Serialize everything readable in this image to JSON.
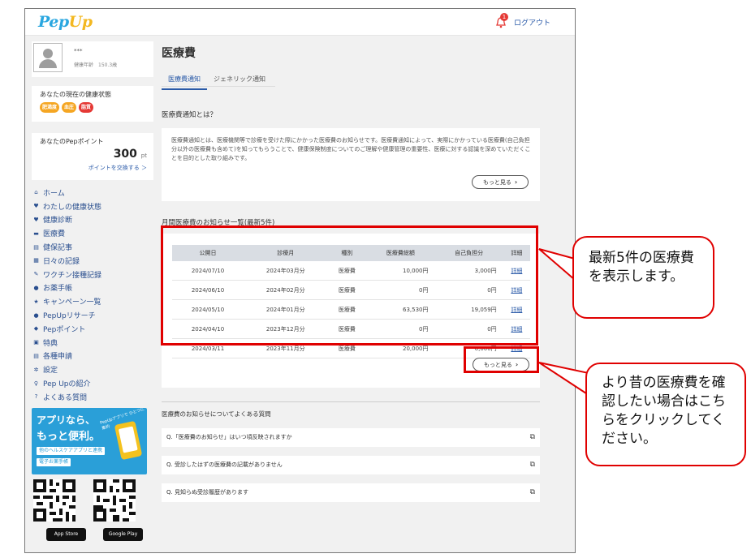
{
  "header": {
    "logo_main": "Pep",
    "logo_accent": "Up",
    "notification_count": "1",
    "logout": "ログアウト"
  },
  "user": {
    "name": "***",
    "info": "健康年齢　150.3歳"
  },
  "health": {
    "title": "あなたの現在の健康状態",
    "badges": [
      {
        "label": "肥満度",
        "color": "#f5a623"
      },
      {
        "label": "血圧",
        "color": "#f5a623"
      },
      {
        "label": "脂質",
        "color": "#e53935"
      }
    ]
  },
  "points": {
    "title": "あなたのPepポイント",
    "value": "300",
    "unit": "pt",
    "link": "ポイントを交換する ＞"
  },
  "menu": [
    {
      "icon": "home-icon",
      "glyph": "⌂",
      "label": "ホーム"
    },
    {
      "icon": "heart-pulse-icon",
      "glyph": "♥",
      "label": "わたしの健康状態"
    },
    {
      "icon": "heart-icon",
      "glyph": "♥",
      "label": "健康診断"
    },
    {
      "icon": "card-icon",
      "glyph": "▬",
      "label": "医療費"
    },
    {
      "icon": "news-icon",
      "glyph": "▤",
      "label": "健保記事"
    },
    {
      "icon": "calendar-icon",
      "glyph": "▦",
      "label": "日々の記録"
    },
    {
      "icon": "syringe-icon",
      "glyph": "✎",
      "label": "ワクチン接種記録"
    },
    {
      "icon": "pill-icon",
      "glyph": "●",
      "label": "お薬手帳"
    },
    {
      "icon": "star-icon",
      "glyph": "★",
      "label": "キャンペーン一覧"
    },
    {
      "icon": "research-icon",
      "glyph": "●",
      "label": "PepUpリサーチ"
    },
    {
      "icon": "coins-icon",
      "glyph": "◆",
      "label": "Pepポイント"
    },
    {
      "icon": "gift-icon",
      "glyph": "▣",
      "label": "特典"
    },
    {
      "icon": "document-icon",
      "glyph": "▤",
      "label": "各種申請"
    },
    {
      "icon": "gear-icon",
      "glyph": "✲",
      "label": "設定"
    },
    {
      "icon": "pin-icon",
      "glyph": "♀",
      "label": "Pep Upの紹介"
    },
    {
      "icon": "question-icon",
      "glyph": "?",
      "label": "よくある質問"
    }
  ],
  "promo": {
    "line1": "アプリなら、",
    "line2": "もっと便利。",
    "tag1": "他のヘルスケアアプリと連携",
    "tag2": "電子お薬手帳",
    "circle_text": "PepUpアプリで ひとつに集約"
  },
  "stores": {
    "apple": "App Store",
    "google": "Google Play"
  },
  "page": {
    "title": "医療費",
    "tabs": [
      "医療費通知",
      "ジェネリック通知"
    ]
  },
  "about": {
    "heading": "医療費通知とは？",
    "text": "医療費通知とは、医療機関等で診療を受けた際にかかった医療費のお知らせです。医療費通知によって、実際にかかっている医療費(自己負担分以外の医療費も含めて)を知ってもらうことで、健康保険制度についてのご理解や健康管理の重要性、医療に対する認識を深めていただくことを目的とした取り組みです。",
    "more": "もっと見る"
  },
  "monthly": {
    "heading": "月間医療費のお知らせ一覧(最新5件)",
    "columns": [
      "公開日",
      "診療月",
      "種別",
      "医療費総額",
      "自己負担分",
      "詳細"
    ],
    "rows": [
      [
        "2024/07/10",
        "2024年03月分",
        "医療費",
        "10,000円",
        "3,000円",
        "詳細"
      ],
      [
        "2024/06/10",
        "2024年02月分",
        "医療費",
        "0円",
        "0円",
        "詳細"
      ],
      [
        "2024/05/10",
        "2024年01月分",
        "医療費",
        "63,530円",
        "19,059円",
        "詳細"
      ],
      [
        "2024/04/10",
        "2023年12月分",
        "医療費",
        "0円",
        "0円",
        "詳細"
      ],
      [
        "2024/03/11",
        "2023年11月分",
        "医療費",
        "20,000円",
        "6,000円",
        "詳細"
      ]
    ],
    "more": "もっと見る"
  },
  "faq": {
    "heading": "医療費のお知らせについてよくある質問",
    "items": [
      "Q.「医療費のお知らせ」はいつ頃反映されますか",
      "Q. 受診したはずの医療費の記載がありません",
      "Q. 見知らぬ受診履歴があります"
    ]
  },
  "callouts": {
    "first": "最新5件の医療費を表示します。",
    "second": "より昔の医療費を確認したい場合はこちらをクリックしてください。"
  }
}
